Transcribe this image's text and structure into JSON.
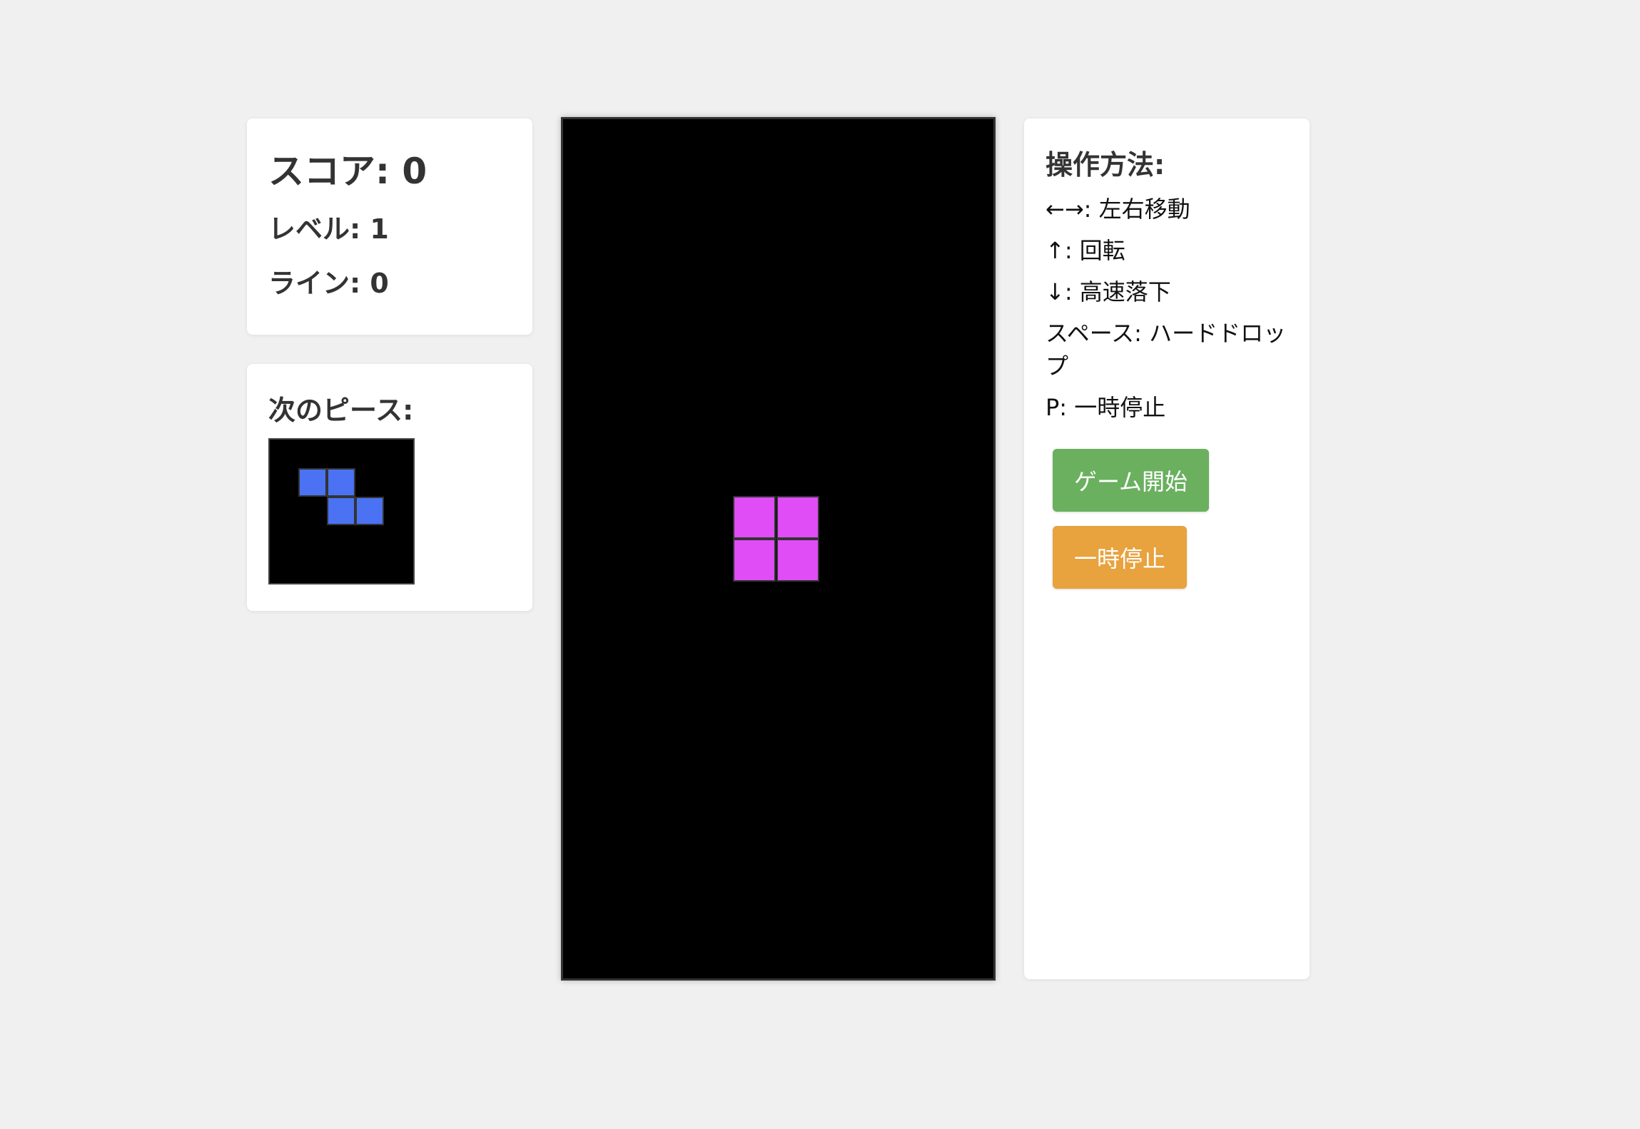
{
  "stats": {
    "score": "スコア: 0",
    "level": "レベル: 1",
    "lines": "ライン: 0"
  },
  "next": {
    "title": "次のピース:",
    "piece": {
      "name": "Z",
      "color": "#4a72f2",
      "cells": [
        [
          0,
          0
        ],
        [
          1,
          0
        ],
        [
          1,
          1
        ],
        [
          2,
          1
        ]
      ]
    }
  },
  "board": {
    "columns": 10,
    "rows": 20,
    "active_piece": {
      "name": "O",
      "color": "#e04cf5",
      "cells": [
        [
          4,
          9
        ],
        [
          5,
          9
        ],
        [
          4,
          10
        ],
        [
          5,
          10
        ]
      ]
    }
  },
  "help": {
    "title": "操作方法:",
    "lines": [
      "←→: 左右移動",
      "↑: 回転",
      "↓: 高速落下",
      "スペース: ハードドロップ",
      "P: 一時停止"
    ]
  },
  "buttons": {
    "start": {
      "label": "ゲーム開始",
      "color": "#6ab05f"
    },
    "pause": {
      "label": "一時停止",
      "color": "#e8a23e"
    }
  }
}
